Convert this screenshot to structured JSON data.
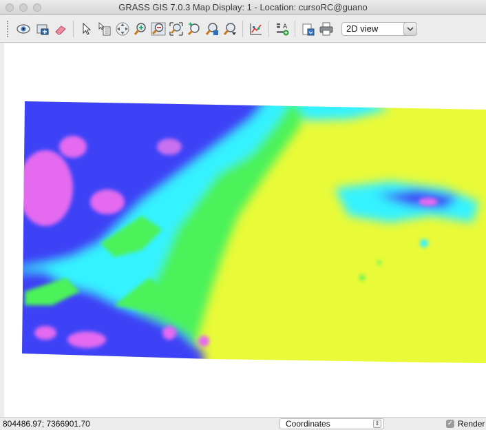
{
  "window": {
    "title": "GRASS GIS 7.0.3 Map Display: 1  - Location: cursoRC@guano"
  },
  "toolbar": {
    "tools": [
      "display-map-icon",
      "render-map-icon",
      "erase-display-icon",
      "pointer-icon",
      "query-icon",
      "pan-icon",
      "zoom-in-icon",
      "zoom-out-icon",
      "zoom-extent-icon",
      "zoom-back-icon",
      "zoom-region-icon",
      "zoom-menu-icon",
      "analyze-icon",
      "decoration-icon",
      "save-image-icon",
      "print-icon"
    ],
    "view_mode": "2D view"
  },
  "map": {
    "colors": {
      "magenta": "#e46af0",
      "blue": "#3c43f6",
      "cyan": "#36f2ff",
      "green": "#4cf25a",
      "yellow": "#e9fa38"
    }
  },
  "statusbar": {
    "coordinates": "804486.97; 7366901.70",
    "display_mode": "Coordinates",
    "render_label": "Render",
    "render_checked": true
  }
}
